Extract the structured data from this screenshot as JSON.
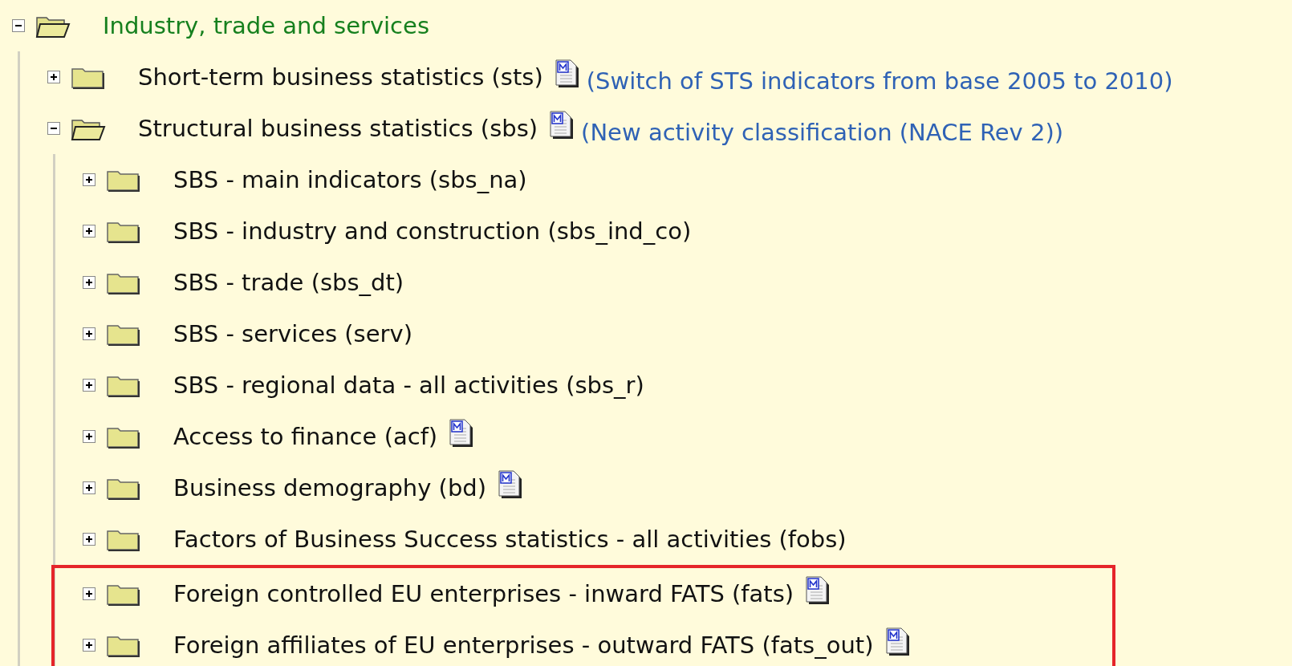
{
  "tree": {
    "label": "Industry, trade and services",
    "expanded": true,
    "children": [
      {
        "label": "Short-term business statistics (sts)",
        "expanded": false,
        "metadata": true,
        "note": "(Switch of STS indicators from base 2005 to 2010)",
        "highlighted": false
      },
      {
        "label": "Structural business statistics (sbs)",
        "expanded": true,
        "metadata": true,
        "note": "(New activity classification (NACE Rev 2))",
        "highlighted": false,
        "children": [
          {
            "label": "SBS - main indicators (sbs_na)",
            "expanded": false,
            "metadata": false,
            "highlighted": false
          },
          {
            "label": "SBS - industry and construction (sbs_ind_co)",
            "expanded": false,
            "metadata": false,
            "highlighted": false
          },
          {
            "label": "SBS - trade (sbs_dt)",
            "expanded": false,
            "metadata": false,
            "highlighted": false
          },
          {
            "label": "SBS - services (serv)",
            "expanded": false,
            "metadata": false,
            "highlighted": false
          },
          {
            "label": "SBS - regional data - all activities (sbs_r)",
            "expanded": false,
            "metadata": false,
            "highlighted": false
          },
          {
            "label": "Access to finance (acf)",
            "expanded": false,
            "metadata": true,
            "highlighted": false
          },
          {
            "label": "Business demography (bd)",
            "expanded": false,
            "metadata": true,
            "highlighted": false
          },
          {
            "label": "Factors of Business Success statistics - all activities (fobs)",
            "expanded": false,
            "metadata": false,
            "highlighted": false
          },
          {
            "label": "Foreign controlled EU enterprises - inward FATS (fats)",
            "expanded": false,
            "metadata": true,
            "highlighted": true
          },
          {
            "label": "Foreign affiliates of EU enterprises - outward FATS (fats_out)",
            "expanded": false,
            "metadata": true,
            "highlighted": true
          }
        ]
      }
    ]
  }
}
